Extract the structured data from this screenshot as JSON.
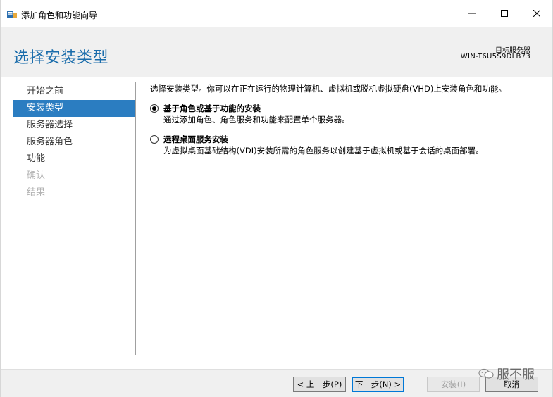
{
  "window": {
    "title": "添加角色和功能向导"
  },
  "header": {
    "page_title": "选择安装类型",
    "destination_label": "目标服务器",
    "destination_server": "WIN-T6U5S9DLB73"
  },
  "nav": {
    "items": [
      {
        "label": "开始之前",
        "state": "normal"
      },
      {
        "label": "安装类型",
        "state": "active"
      },
      {
        "label": "服务器选择",
        "state": "normal"
      },
      {
        "label": "服务器角色",
        "state": "normal"
      },
      {
        "label": "功能",
        "state": "normal"
      },
      {
        "label": "确认",
        "state": "disabled"
      },
      {
        "label": "结果",
        "state": "disabled"
      }
    ]
  },
  "content": {
    "intro": "选择安装类型。你可以在正在运行的物理计算机、虚拟机或脱机虚拟硬盘(VHD)上安装角色和功能。",
    "options": [
      {
        "title": "基于角色或基于功能的安装",
        "description": "通过添加角色、角色服务和功能来配置单个服务器。",
        "selected": true
      },
      {
        "title": "远程桌面服务安装",
        "description": "为虚拟桌面基础结构(VDI)安装所需的角色服务以创建基于虚拟机或基于会话的桌面部署。",
        "selected": false
      }
    ]
  },
  "footer": {
    "prev_label": "< 上一步(P)",
    "next_label": "下一步(N) >",
    "install_label": "安装(I)",
    "cancel_label": "取消"
  },
  "watermark": {
    "text": "服不服"
  },
  "colors": {
    "accent": "#2b7dc1",
    "title_blue": "#1b6dab"
  }
}
